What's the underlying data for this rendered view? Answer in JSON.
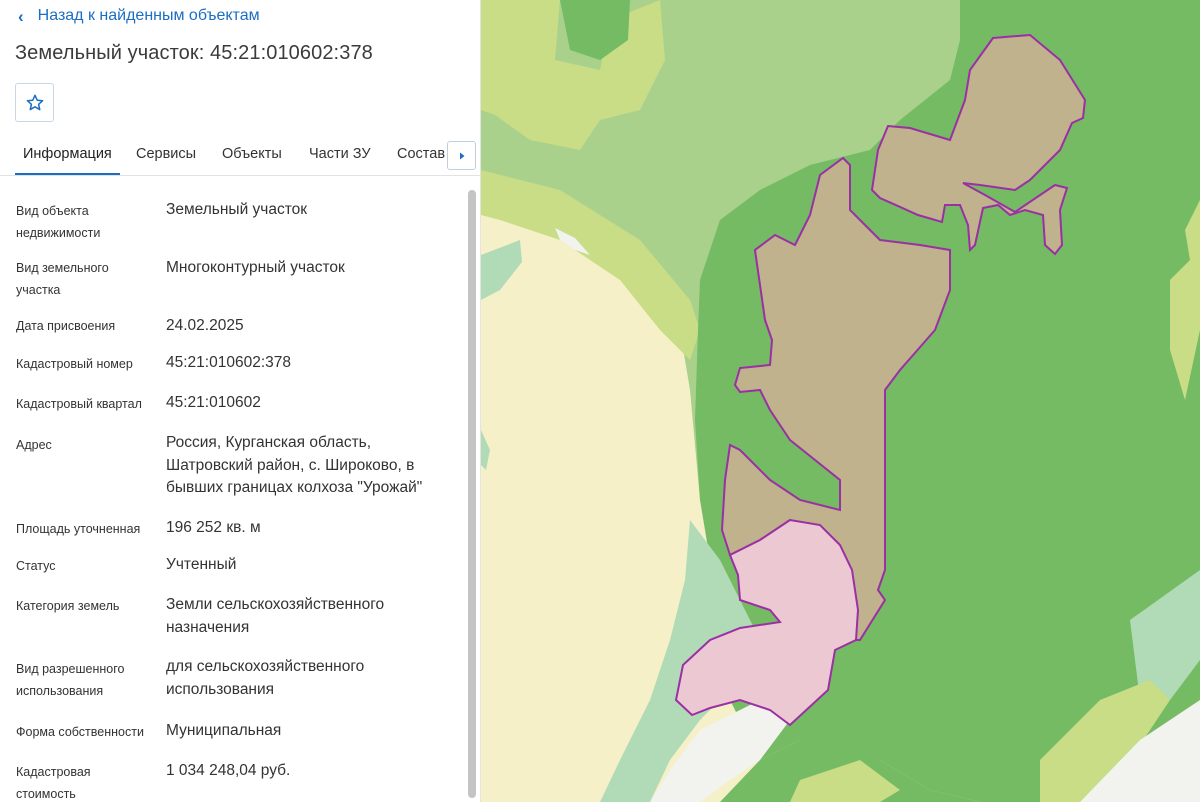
{
  "back_link": "Назад к найденным объектам",
  "title": "Земельный участок: 45:21:010602:378",
  "favorite": {
    "icon": "star-outline-icon"
  },
  "tabs": [
    {
      "label": "Информация",
      "active": true
    },
    {
      "label": "Сервисы"
    },
    {
      "label": "Объекты"
    },
    {
      "label": "Части ЗУ"
    },
    {
      "label": "Состав"
    }
  ],
  "tabs_more_icon": "caret-right-icon",
  "info": [
    {
      "label": "Вид объекта недвижимости",
      "value": "Земельный участок"
    },
    {
      "label": "Вид земельного участка",
      "value": "Многоконтурный участок"
    },
    {
      "label": "Дата присвоения",
      "value": "24.02.2025"
    },
    {
      "label": "Кадастровый номер",
      "value": "45:21:010602:378"
    },
    {
      "label": "Кадастровый квартал",
      "value": "45:21:010602"
    },
    {
      "label": "Адрес",
      "value": "Россия, Курганская область, Шатровский район, с. Широково, в бывших границах колхоза \"Урожай\""
    },
    {
      "label": "Площадь уточненная",
      "value": "196 252 кв. м"
    },
    {
      "label": "Статус",
      "value": "Учтенный"
    },
    {
      "label": "Категория земель",
      "value": "Земли сельскохозяйственного назначения"
    },
    {
      "label": "Вид разрешенного использования",
      "value": "для сельскохозяйственного использования"
    },
    {
      "label": "Форма собственности",
      "value": "Муниципальная"
    },
    {
      "label": "Кадастровая стоимость",
      "value": "1 034 248,04 руб."
    }
  ],
  "colors": {
    "link": "#1b6ec2",
    "parcel_outline": "#9b2fa4",
    "parcel_fill": "#bfb28c",
    "parcel_fill_highlight": "#ecc8d2",
    "forest_dark": "#74bb64",
    "forest_light": "#a9d18c",
    "field": "#f6f0c8",
    "meadow": "#c8dd86",
    "wetland": "#b1dbb6"
  }
}
